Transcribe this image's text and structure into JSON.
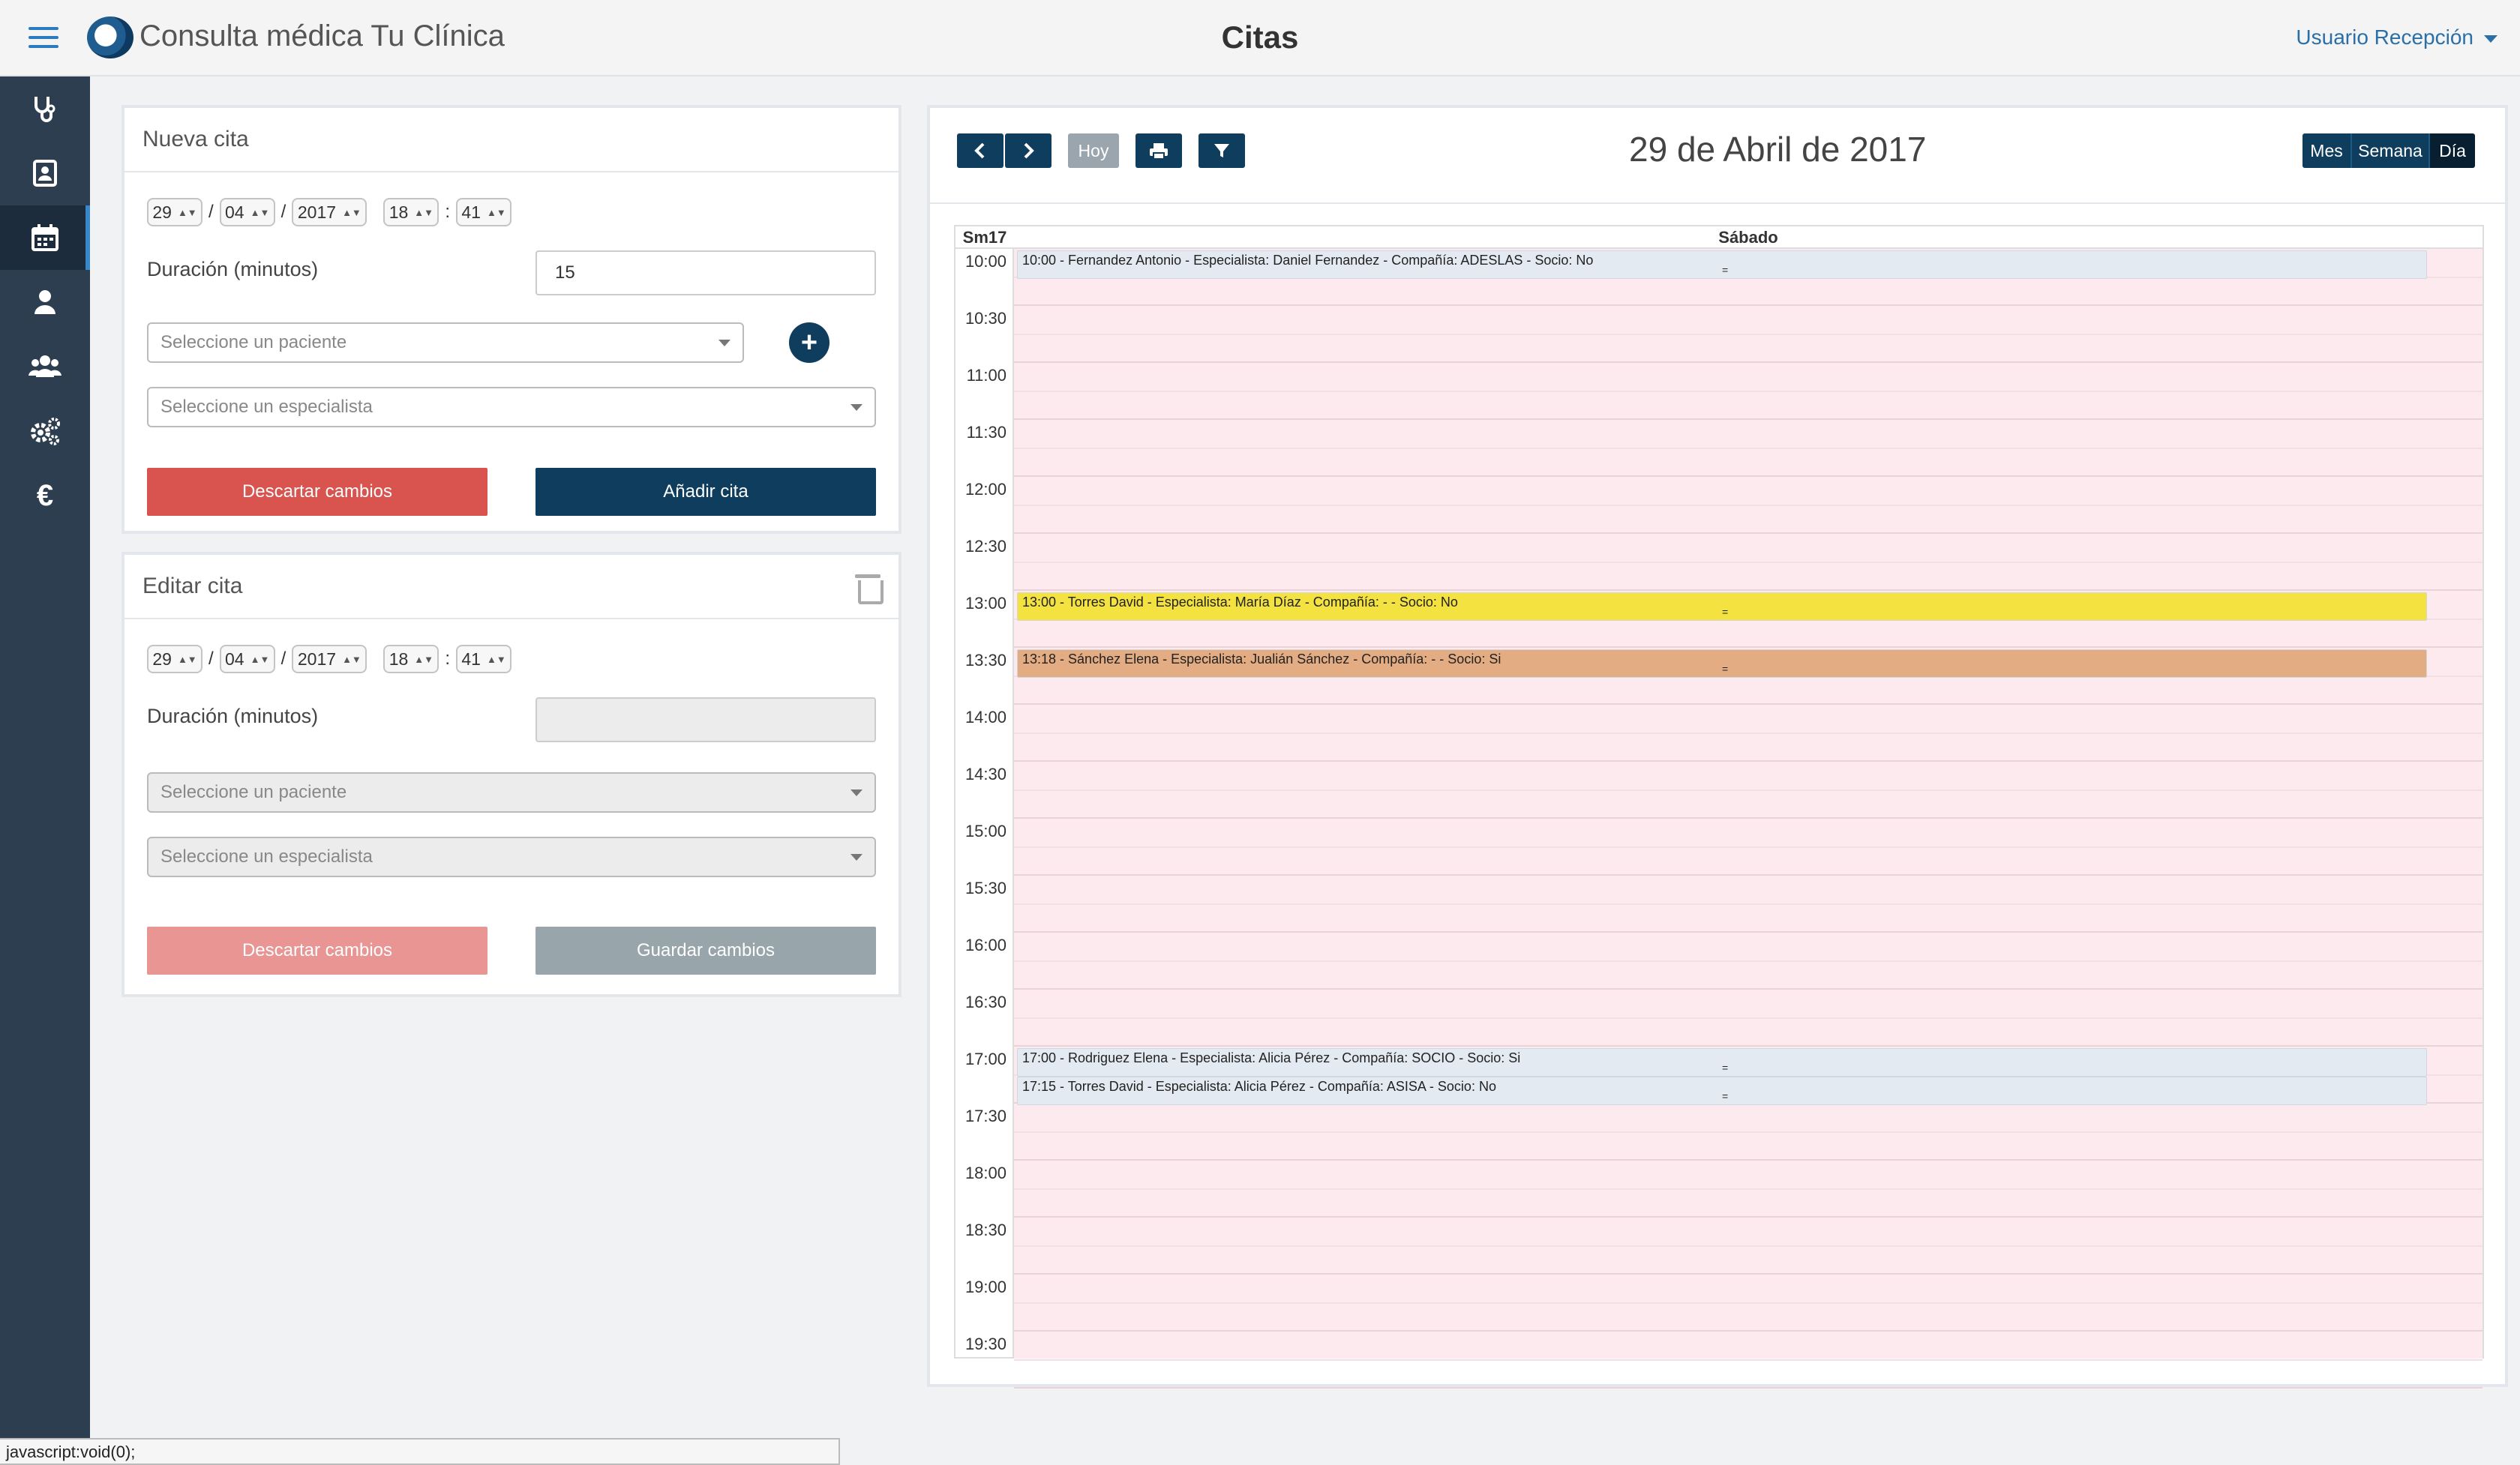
{
  "app": {
    "title": "Consulta médica Tu Clínica",
    "page_title": "Citas",
    "user_menu": "Usuario Recepción"
  },
  "sidebar": {
    "items": [
      {
        "icon": "stethoscope-icon"
      },
      {
        "icon": "contact-card-icon"
      },
      {
        "icon": "calendar-icon",
        "active": true
      },
      {
        "icon": "user-icon"
      },
      {
        "icon": "users-icon"
      },
      {
        "icon": "gears-icon"
      },
      {
        "icon": "euro-icon",
        "glyph": "€"
      }
    ]
  },
  "nueva_cita": {
    "heading": "Nueva cita",
    "day": "29",
    "month": "04",
    "year": "2017",
    "hour": "18",
    "minute": "41",
    "date_sep": "/",
    "time_sep": ":",
    "duration_label": "Duración (minutos)",
    "duration_value": "15",
    "patient_placeholder": "Seleccione un paciente",
    "specialist_placeholder": "Seleccione un especialista",
    "discard_label": "Descartar cambios",
    "add_label": "Añadir cita"
  },
  "editar_cita": {
    "heading": "Editar cita",
    "day": "29",
    "month": "04",
    "year": "2017",
    "hour": "18",
    "minute": "41",
    "date_sep": "/",
    "time_sep": ":",
    "duration_label": "Duración (minutos)",
    "duration_value": "",
    "patient_placeholder": "Seleccione un paciente",
    "specialist_placeholder": "Seleccione un especialista",
    "discard_label": "Descartar cambios",
    "save_label": "Guardar cambios"
  },
  "calendar": {
    "today_label": "Hoy",
    "date_title": "29 de Abril de 2017",
    "views": [
      "Mes",
      "Semana",
      "Día"
    ],
    "active_view": "Día",
    "week_label": "Sm17",
    "day_label": "Sábado",
    "time_slots": [
      "10:00",
      "10:30",
      "11:00",
      "11:30",
      "12:00",
      "12:30",
      "13:00",
      "13:30",
      "14:00",
      "14:30",
      "15:00",
      "15:30",
      "16:00",
      "16:30",
      "17:00",
      "17:30",
      "18:00",
      "18:30",
      "19:00",
      "19:30"
    ],
    "events": [
      {
        "text": "10:00 - Fernandez Antonio - Especialista: Daniel Fernandez - Compañía: ADESLAS - Socio: No",
        "color": "#e4eaf1"
      },
      {
        "text": "13:00 - Torres David - Especialista: María Díaz - Compañía: - - Socio: No",
        "color": "#f3e240"
      },
      {
        "text": "13:18 - Sánchez Elena - Especialista: Jualián Sánchez - Compañía: - - Socio: Si",
        "color": "#e3ac82"
      },
      {
        "text": "17:00 - Rodriguez Elena - Especialista: Alicia Pérez - Compañía: SOCIO - Socio: Si",
        "color": "#e4eaf1"
      },
      {
        "text": "17:15 - Torres David - Especialista: Alicia Pérez - Compañía: ASISA - Socio: No",
        "color": "#e4eaf1"
      }
    ],
    "resize_grip": "="
  },
  "status_bar": "javascript:void(0);",
  "colors": {
    "sidebar": "#2d3e50",
    "navy": "#0f3d5e",
    "danger": "#d9534f",
    "calendar_bg": "#fdeaef"
  }
}
